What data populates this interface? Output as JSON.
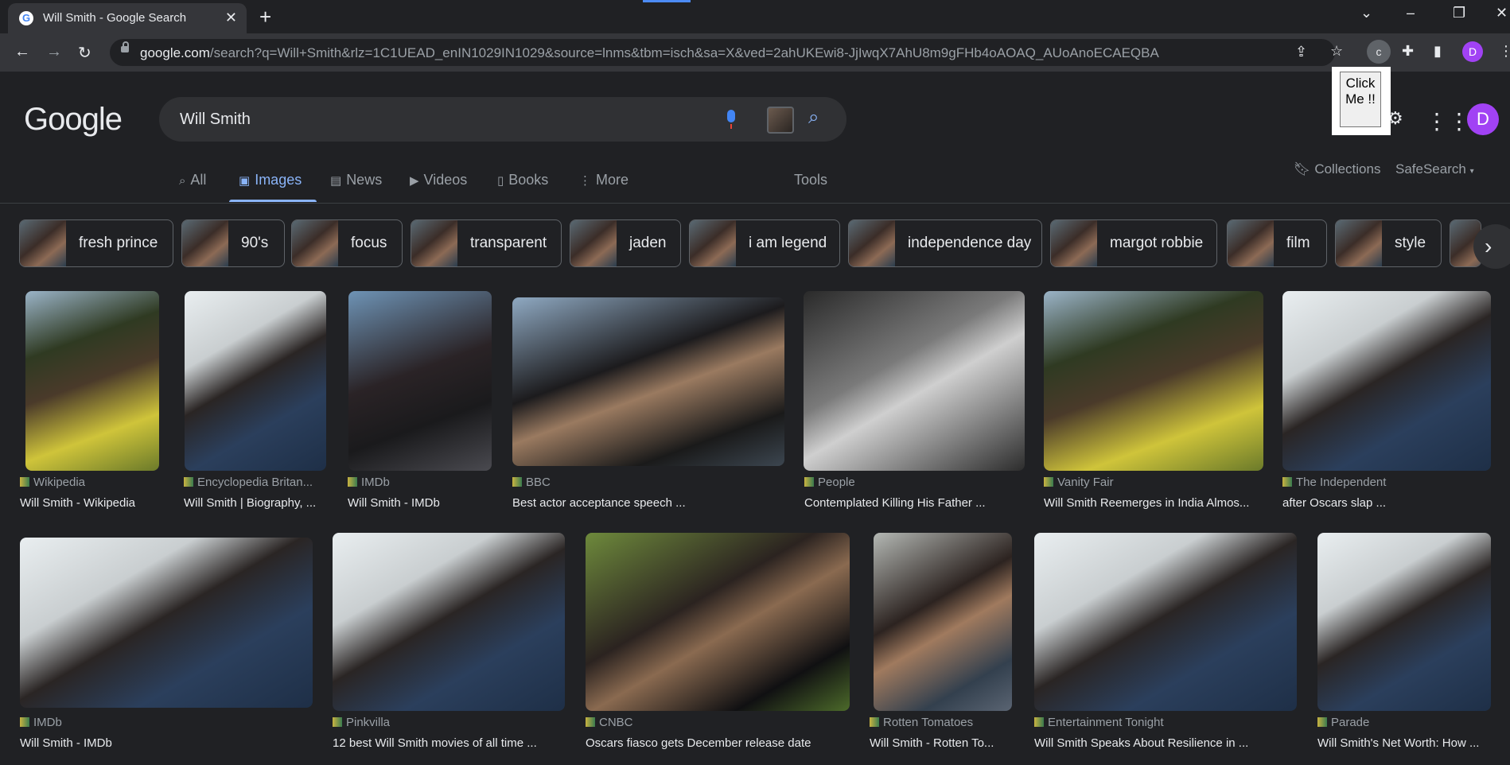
{
  "browser": {
    "tab_title": "Will Smith - Google Search",
    "url_host": "google.com",
    "url_path": "/search?q=Will+Smith&rlz=1C1UEAD_enIN1029IN1029&source=lnms&tbm=isch&sa=X&ved=2ahUKEwi8-JjIwqX7AhU8m9gFHb4oAOAQ_AUoAnoECAEQBA",
    "extension_letter": "c",
    "profile_letter": "D"
  },
  "popup": {
    "click_me": "Click Me !!"
  },
  "google": {
    "logo": "Google",
    "query": "Will Smith",
    "avatar_letter": "D"
  },
  "tabs": [
    {
      "label": "All"
    },
    {
      "label": "Images"
    },
    {
      "label": "News"
    },
    {
      "label": "Videos"
    },
    {
      "label": "Books"
    },
    {
      "label": "More"
    }
  ],
  "tools": "Tools",
  "collections": "Collections",
  "safesearch": "SafeSearch",
  "chips": [
    {
      "label": "fresh prince"
    },
    {
      "label": "90's"
    },
    {
      "label": "focus"
    },
    {
      "label": "transparent"
    },
    {
      "label": "jaden"
    },
    {
      "label": "i am legend"
    },
    {
      "label": "independence day"
    },
    {
      "label": "margot robbie"
    },
    {
      "label": "film"
    },
    {
      "label": "style"
    }
  ],
  "results_row1": [
    {
      "source": "Wikipedia",
      "title": "Will Smith - Wikipedia"
    },
    {
      "source": "Encyclopedia Britan...",
      "title": "Will Smith | Biography, ..."
    },
    {
      "source": "IMDb",
      "title": "Will Smith - IMDb"
    },
    {
      "source": "BBC",
      "title": "Best actor acceptance speech ..."
    },
    {
      "source": "People",
      "title": "Contemplated Killing His Father ..."
    },
    {
      "source": "Vanity Fair",
      "title": "Will Smith Reemerges in India Almos..."
    },
    {
      "source": "The Independent",
      "title": "after Oscars slap ..."
    }
  ],
  "results_row2": [
    {
      "source": "IMDb",
      "title": "Will Smith - IMDb"
    },
    {
      "source": "Pinkvilla",
      "title": "12 best Will Smith movies of all time ..."
    },
    {
      "source": "CNBC",
      "title": "Oscars fiasco gets December release date"
    },
    {
      "source": "Rotten Tomatoes",
      "title": "Will Smith - Rotten To..."
    },
    {
      "source": "Entertainment Tonight",
      "title": "Will Smith Speaks About Resilience in ..."
    },
    {
      "source": "Parade",
      "title": "Will Smith's Net Worth: How ..."
    }
  ]
}
